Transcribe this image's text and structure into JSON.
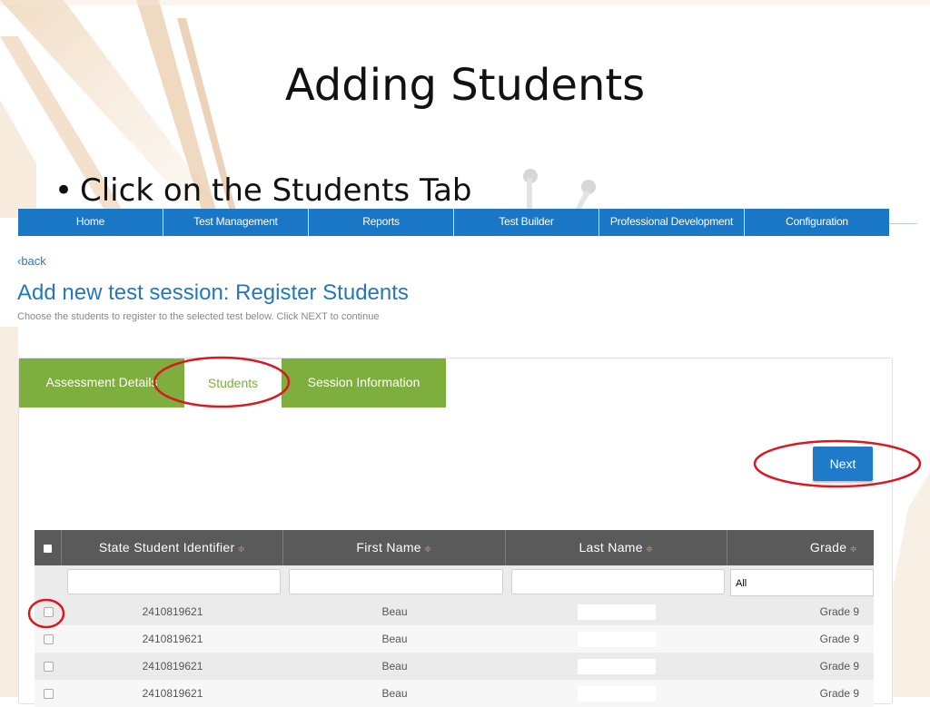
{
  "slide": {
    "title": "Adding Students",
    "bullet": "Click on the Students Tab"
  },
  "nav": {
    "items": [
      "Home",
      "Test Management",
      "Reports",
      "Test Builder",
      "Professional Development",
      "Configuration"
    ]
  },
  "page": {
    "back": "‹back",
    "title": "Add new test session: Register Students",
    "subtitle": "Choose the students to register to the selected test below. Click NEXT to continue"
  },
  "tabs": [
    "Assessment Details",
    "Students",
    "Session Information"
  ],
  "next_label": "Next",
  "table": {
    "headers": [
      "State Student Identifier",
      "First Name",
      "Last Name",
      "Grade"
    ],
    "grade_filter": "All",
    "rows": [
      {
        "id": "2410819621",
        "first": "Beau",
        "grade": "Grade 9"
      },
      {
        "id": "2410819621",
        "first": "Beau",
        "grade": "Grade 9"
      },
      {
        "id": "2410819621",
        "first": "Beau",
        "grade": "Grade 9"
      },
      {
        "id": "2410819621",
        "first": "Beau",
        "grade": "Grade 9"
      }
    ]
  },
  "colors": {
    "nav": "#1977c6",
    "tab_green": "#7eae3d",
    "next_button": "#1f7bc9",
    "annotation": "#d9181f"
  }
}
